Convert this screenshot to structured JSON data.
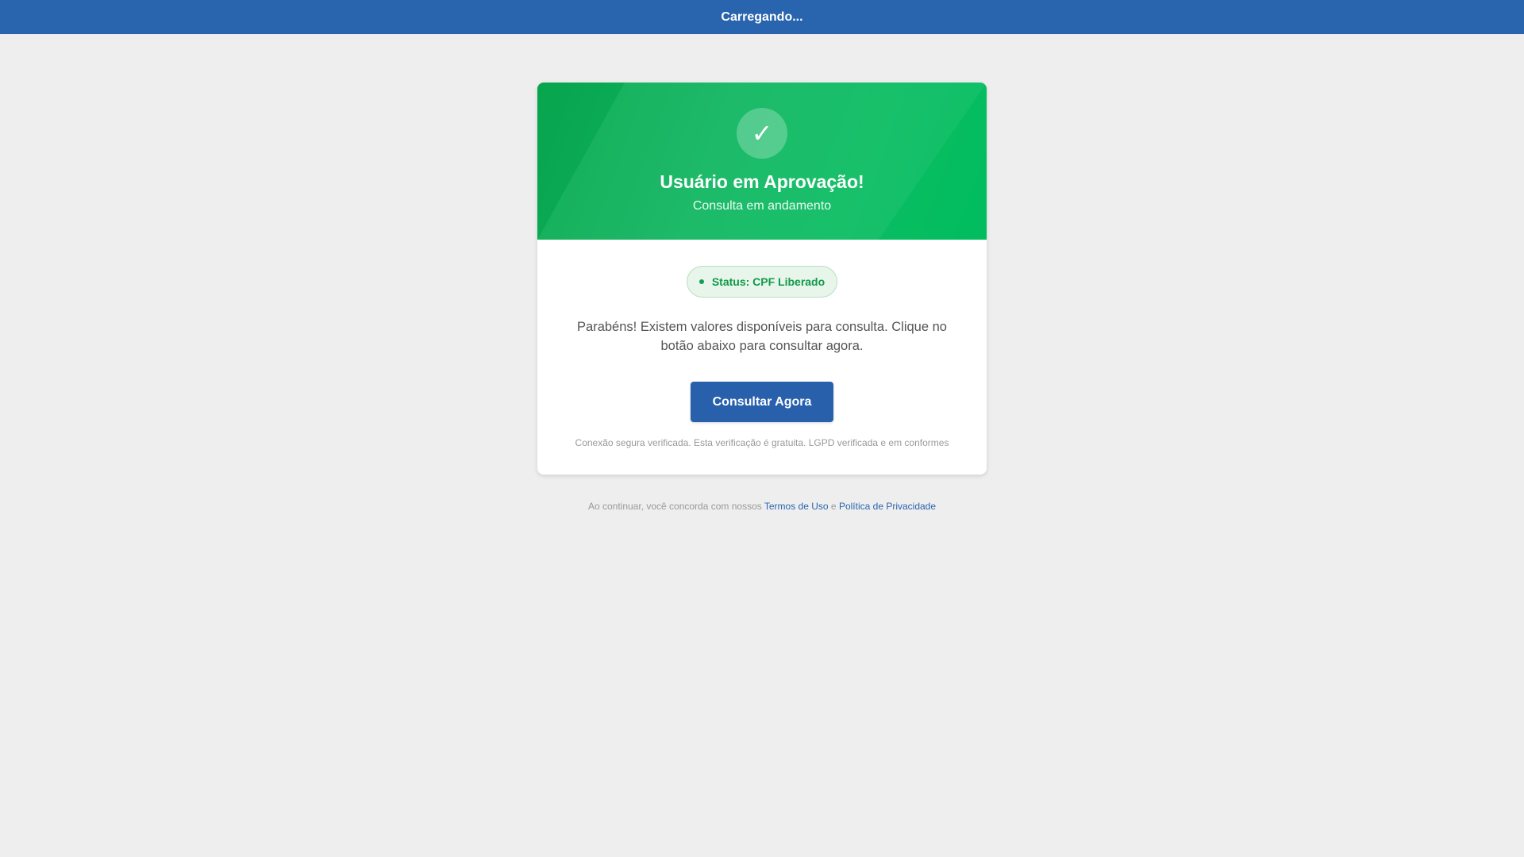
{
  "topbar": {
    "title": "Carregando..."
  },
  "card": {
    "header": {
      "icon": "check-icon",
      "icon_glyph": "✓",
      "title": "Usuário em Aprovação!",
      "subtitle": "Consulta em andamento"
    },
    "status": {
      "label": "Status: CPF Liberado"
    },
    "message": "Parabéns! Existem valores disponíveis para consulta. Clique no botão abaixo para consultar agora.",
    "button_label": "Consultar Agora",
    "secure_note": "Conexão segura verificada. Esta verificação é gratuita. LGPD verificada e em conformes"
  },
  "footer": {
    "prefix": "Ao continuar, você concorda com nossos",
    "terms_link": "Termos de Uso",
    "conjunction": "e",
    "privacy_link": "Política de Privacidade"
  },
  "colors": {
    "topbar": "#2964ae",
    "header_green": "#0cbd62",
    "button": "#2860ac",
    "status_text": "#119a4a",
    "background": "#eeeeee"
  }
}
